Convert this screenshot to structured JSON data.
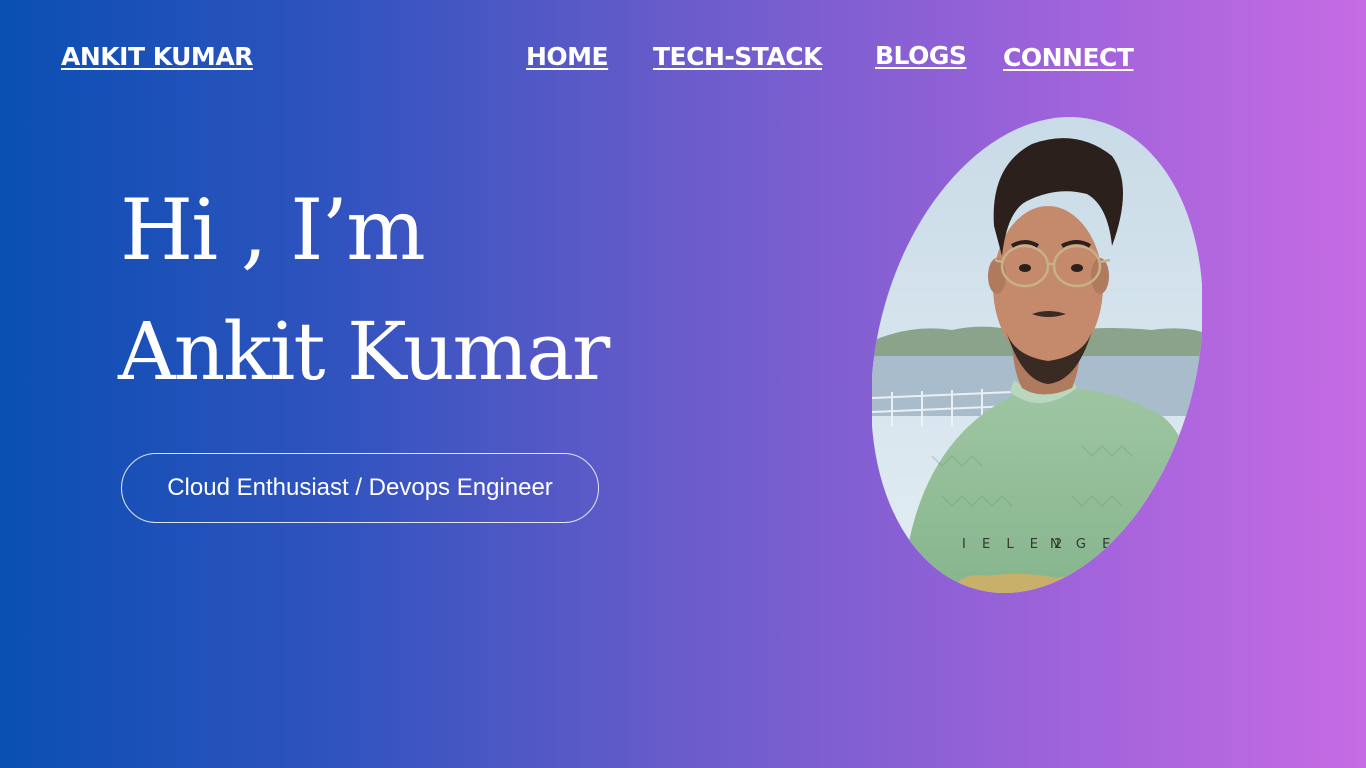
{
  "header": {
    "brand": "ANKIT KUMAR",
    "nav": [
      "HOME",
      "TECH-STACK",
      "BLOGS",
      "CONNECT"
    ]
  },
  "hero": {
    "greeting": "Hi ,  I’m",
    "name": "Ankit Kumar",
    "role": "Cloud Enthusiast / Devops Engineer"
  },
  "photo": {
    "shirt_text_left": "I E L E 2",
    "shirt_text_right": "N G E L"
  },
  "colors": {
    "gradient_start": "#0a4fb2",
    "gradient_end": "#c66be4",
    "text": "#ffffff"
  }
}
